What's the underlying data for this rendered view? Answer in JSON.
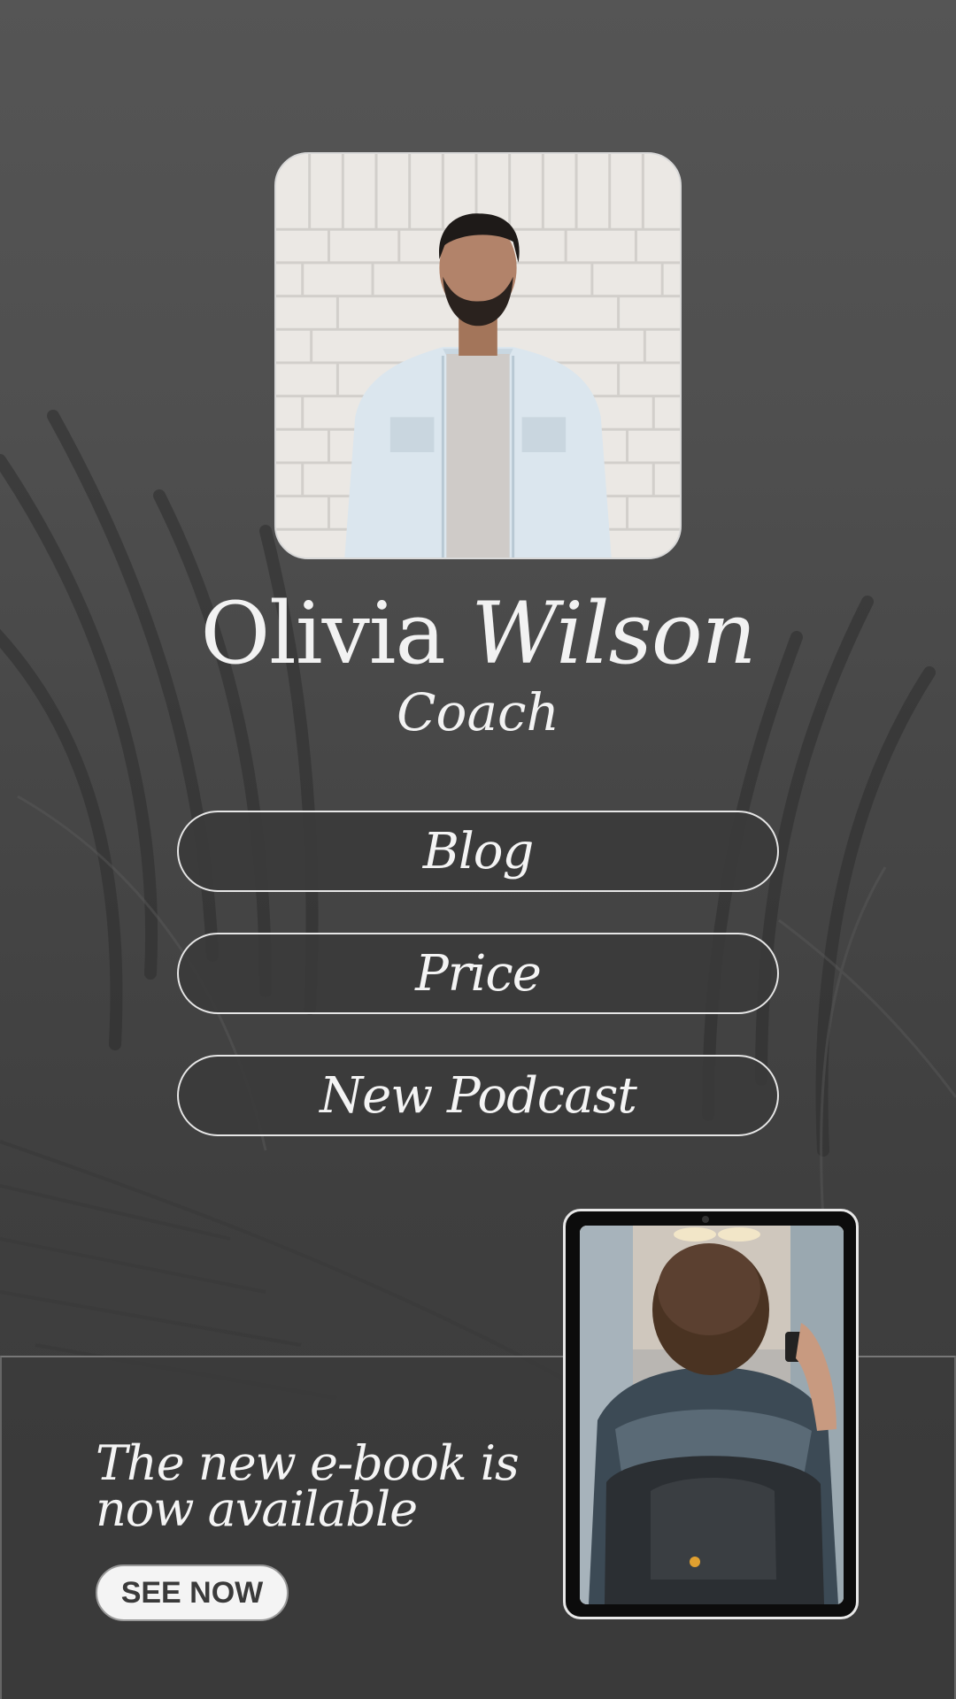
{
  "profile": {
    "first_name": "Olivia",
    "last_name": "Wilson",
    "role": "Coach"
  },
  "links": {
    "blog": "Blog",
    "price": "Price",
    "podcast": "New Podcast"
  },
  "promo": {
    "headline_line1": "The new e-book is",
    "headline_line2": "now available",
    "cta": "SEE NOW"
  },
  "colors": {
    "background": "#4e4e4e",
    "button_fill": "#3a3a3a",
    "text": "#f2f2f2"
  }
}
